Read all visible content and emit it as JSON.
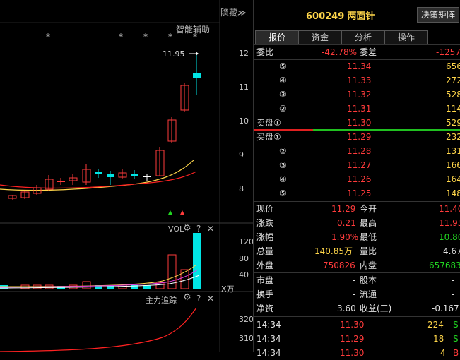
{
  "header": {
    "hide_label": "隐藏≫",
    "smart_assist": "智能辅助",
    "stock_code": "600249",
    "stock_name": "两面针",
    "decision_button": "决策矩阵"
  },
  "kline": {
    "price_marker": "11.95",
    "y_labels": [
      "12",
      "11",
      "10",
      "9",
      "8"
    ],
    "stars": [
      "*",
      "*",
      "*",
      "*",
      "*"
    ]
  },
  "volume_panel": {
    "title": "VOL",
    "y_labels": [
      "120",
      "80",
      "40"
    ],
    "unit": "X万",
    "help": "?",
    "close": "✕"
  },
  "mainforce_panel": {
    "title": "主力追踪",
    "y_labels": [
      "320",
      "310"
    ],
    "help": "?",
    "close": "✕"
  },
  "tabs": [
    "报价",
    "资金",
    "分析",
    "操作"
  ],
  "weibi": {
    "label": "委比",
    "value": "-42.78%",
    "label2": "委差",
    "value2": "-1257"
  },
  "sell_orders": [
    {
      "label": "⑤",
      "price": "11.34",
      "vol": "656"
    },
    {
      "label": "④",
      "price": "11.33",
      "vol": "272"
    },
    {
      "label": "③",
      "price": "11.32",
      "vol": "528"
    },
    {
      "label": "②",
      "price": "11.31",
      "vol": "114"
    },
    {
      "label": "卖盘①",
      "price": "11.30",
      "vol": "529"
    }
  ],
  "buy_orders": [
    {
      "label": "买盘①",
      "price": "11.29",
      "vol": "232"
    },
    {
      "label": "②",
      "price": "11.28",
      "vol": "131"
    },
    {
      "label": "③",
      "price": "11.27",
      "vol": "166"
    },
    {
      "label": "④",
      "price": "11.26",
      "vol": "164"
    },
    {
      "label": "⑤",
      "price": "11.25",
      "vol": "148"
    }
  ],
  "quote": [
    {
      "l1": "现价",
      "v1": "11.29",
      "l2": "今开",
      "v2": "11.40"
    },
    {
      "l1": "涨跌",
      "v1": "0.21",
      "l2": "最高",
      "v2": "11.95"
    },
    {
      "l1": "涨幅",
      "v1": "1.90%",
      "l2": "最低",
      "v2": "10.80"
    },
    {
      "l1": "总量",
      "v1": "140.85万",
      "l2": "量比",
      "v2": "4.67"
    },
    {
      "l1": "外盘",
      "v1": "750826",
      "l2": "内盘",
      "v2": "657683"
    }
  ],
  "fundamentals": [
    {
      "l1": "市盘",
      "v1": "-",
      "l2": "股本",
      "v2": "-"
    },
    {
      "l1": "换手",
      "v1": "-",
      "l2": "流通",
      "v2": "-"
    },
    {
      "l1": "净资",
      "v1": "3.60",
      "l2": "收益(三)",
      "v2": "-0.167"
    }
  ],
  "ticks": [
    {
      "time": "14:34",
      "price": "11.30",
      "vol": "224",
      "dir": "S"
    },
    {
      "time": "14:34",
      "price": "11.29",
      "vol": "18",
      "dir": "S"
    },
    {
      "time": "14:34",
      "price": "11.30",
      "vol": "4",
      "dir": "B"
    }
  ],
  "colors": {
    "up": "#ff3b3b",
    "down": "#21d421",
    "cyan": "#00e5e5",
    "yellow": "#ffd64a"
  }
}
